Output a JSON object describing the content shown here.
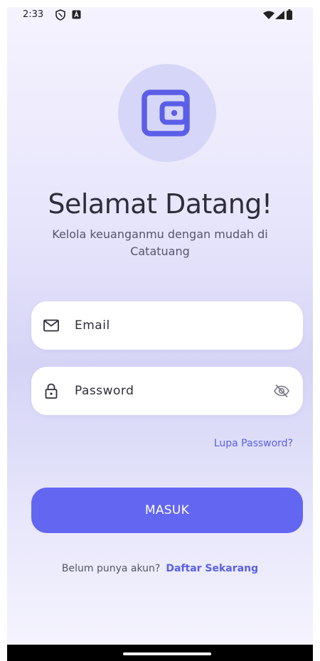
{
  "status_bar": {
    "time": "2:33"
  },
  "login": {
    "title": "Selamat Datang!",
    "subtitle": "Kelola keuanganmu dengan mudah di Catatuang",
    "email_placeholder": "Email",
    "password_placeholder": "Password",
    "forgot_link": "Lupa Password?",
    "submit_label": "MASUK",
    "register_prompt": "Belum punya akun?",
    "register_link": "Daftar Sekarang"
  },
  "icons": {
    "logo": "wallet-icon",
    "email": "mail-icon",
    "password": "lock-icon",
    "toggle": "eye-off-icon"
  },
  "colors": {
    "accent": "#6366f1",
    "link": "#5a5fe8",
    "logo_bg": "#d6d6f8",
    "field_bg": "#ffffff",
    "text_primary": "#2e2e3a",
    "text_secondary": "#55556a"
  }
}
